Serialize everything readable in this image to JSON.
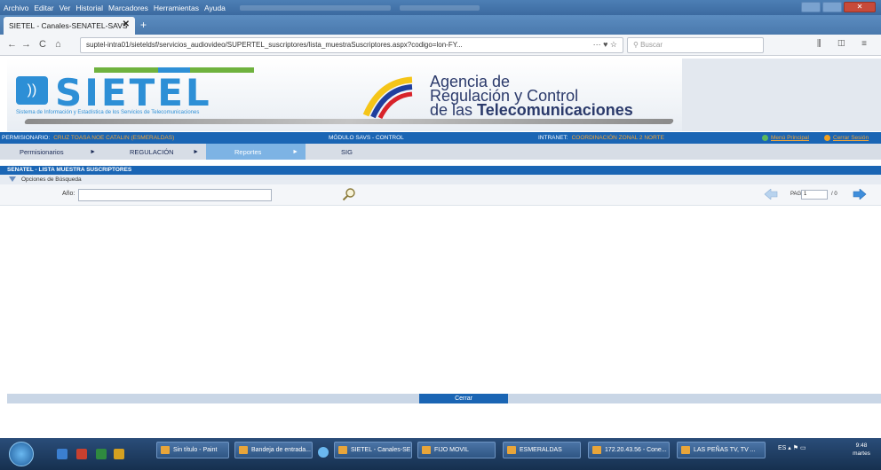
{
  "browser": {
    "menu": [
      "Archivo",
      "Editar",
      "Ver",
      "Historial",
      "Marcadores",
      "Herramientas",
      "Ayuda"
    ],
    "tab_title": "SIETEL - Canales-SENATEL-SAVS",
    "tab_close": "✕",
    "new_tab": "+",
    "url": "suptel-intra01/sieteldsf/servicios_audiovideo/SUPERTEL_suscriptores/lista_muestraSuscriptores.aspx?codigo=lon-FY...",
    "url_actions": "···  ♥  ☆",
    "search_placeholder": "Buscar",
    "nav_back": "←",
    "nav_forward": "→",
    "nav_reload": "C",
    "nav_home": "⌂",
    "nav_right_icons": "⫼ ◫ ≡"
  },
  "banner": {
    "logo_text": "SIETEL",
    "logo_subtitle": "Sistema de Información y Estadística de los Servicios de Telecomunicaciones",
    "agency_line1": "Agencia de",
    "agency_line2": "Regulación y Control",
    "agency_line3_prefix": "de las ",
    "agency_line3_bold": "Telecomunicaciones"
  },
  "info": {
    "permisionario_label": "PERMISIONARIO:",
    "permisionario_value": "CRUZ TOASA NOE CATALIN (ESMERALDAS)",
    "modulo": "MÓDULO SAVS - CONTROL",
    "intranet_label": "INTRANET:",
    "intranet_value": "COORDINACIÓN ZONAL 2 NORTE",
    "menu_principal": "Menú Principal",
    "cerrar_sesion": "Cerrar Sesión"
  },
  "menu": {
    "items": [
      {
        "label": "Permisionarios"
      },
      {
        "label": "REGULACIÓN"
      },
      {
        "label": "Reportes"
      },
      {
        "label": "SIG"
      }
    ],
    "arrow": "►"
  },
  "section": {
    "title": "SENATEL - LISTA   MUESTRA SUSCRIPTORES",
    "search_options": "Opciones de Búsqueda",
    "year_label": "Año:",
    "pag_label": "PAG.",
    "pag_value": "1",
    "pag_total": "/ 0",
    "close_button": "Cerrar"
  },
  "taskbar": {
    "tasks": [
      "Sin título - Paint",
      "Bandeja de entrada...",
      "SIETEL - Canales-SE...",
      "FIJO MOVIL",
      "ESMERALDAS",
      "172.20.43.56 - Cone...",
      "LAS PEÑAS TV, TV ..."
    ],
    "lang": "ES",
    "time": "9:48",
    "day": "martes"
  },
  "colors": {
    "accent_blue": "#1a65b4",
    "logo_blue": "#2d8fd6",
    "orange_text": "#f2a63a",
    "active_menu": "#7db3e4"
  }
}
